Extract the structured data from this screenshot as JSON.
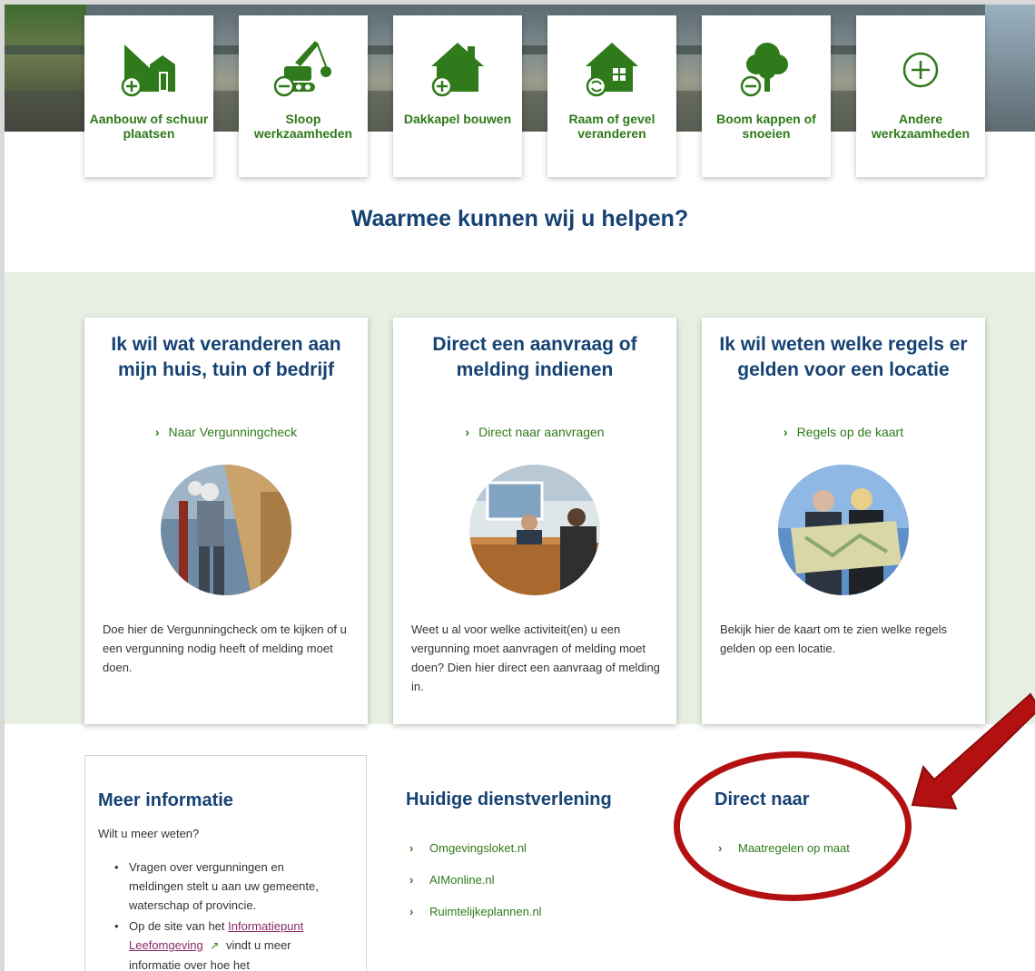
{
  "tiles": [
    {
      "icon": "shed-add-icon",
      "label": "Aanbouw of schuur plaatsen"
    },
    {
      "icon": "crane-demolition-icon",
      "label": "Sloop werkzaamheden"
    },
    {
      "icon": "dormer-house-icon",
      "label": "Dakkapel bouwen"
    },
    {
      "icon": "window-facade-icon",
      "label": "Raam of gevel veranderen"
    },
    {
      "icon": "tree-cut-icon",
      "label": "Boom kappen of snoeien"
    },
    {
      "icon": "plus-circle-icon",
      "label": "Andere werkzaamheden"
    }
  ],
  "help_title": "Waarmee kunnen wij u helpen?",
  "cards": [
    {
      "title": "Ik wil wat veranderen aan mijn huis, tuin of bedrijf",
      "link": "Naar Vergunningcheck",
      "photo": "construction-worker-photo",
      "text": "Doe hier de Vergunningcheck om te kijken of u een vergunning nodig heeft of melding moet doen."
    },
    {
      "title": "Direct een aanvraag of melding indienen",
      "link": "Direct naar aanvragen",
      "photo": "service-desk-photo",
      "text": "Weet u al voor welke activiteit(en) u een vergunning moet aanvragen of melding moet doen? Dien hier direct een aanvraag of melding in."
    },
    {
      "title": "Ik wil weten welke regels er gelden voor een locatie",
      "link": "Regels op de kaart",
      "photo": "couple-with-map-photo",
      "text": "Bekijk hier de kaart om te zien welke regels gelden op een locatie."
    }
  ],
  "meer_info": {
    "title": "Meer informatie",
    "sub": "Wilt u meer weten?",
    "bullet1": "Vragen over vergunningen en meldingen stelt u aan uw gemeente, waterschap of provincie.",
    "bullet2_pre": "Op de site van het",
    "bullet2_link": "Informatiepunt Leefomgeving",
    "bullet2_post": "vindt u meer informatie over hoe het"
  },
  "huidige": {
    "title": "Huidige dienstverlening",
    "links": [
      "Omgevingsloket.nl",
      "AIMonline.nl",
      "Ruimtelijkeplannen.nl"
    ]
  },
  "direct_naar": {
    "title": "Direct naar",
    "links": [
      "Maatregelen op maat"
    ]
  },
  "colors": {
    "green": "#2f7a1a",
    "navy": "#154273",
    "highlight_red": "#b31011",
    "band": "#e7efe3"
  }
}
